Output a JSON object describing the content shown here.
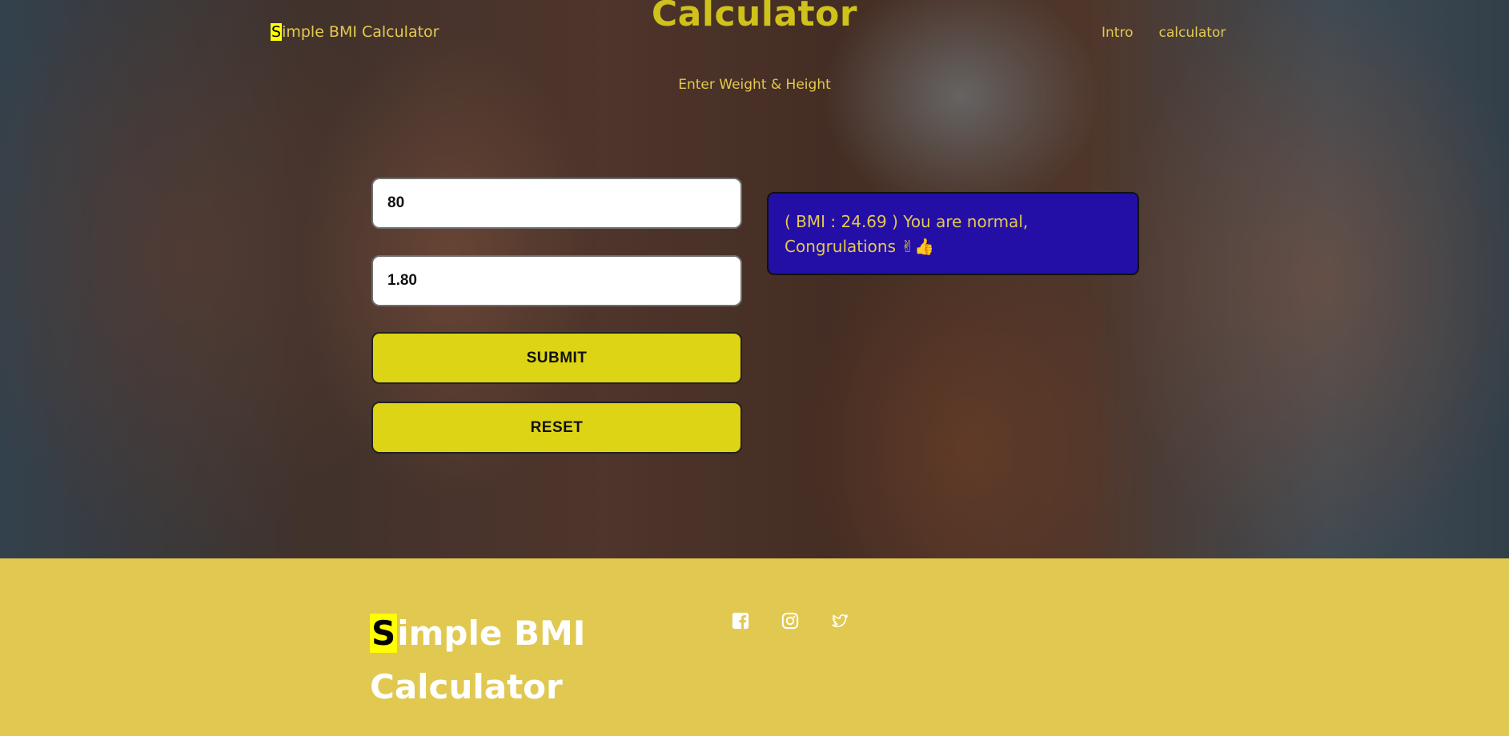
{
  "header": {
    "brand_first": "S",
    "brand_rest": "imple BMI Calculator",
    "title": "Calculator",
    "subtitle": "Enter Weight & Height",
    "nav": [
      {
        "label": "Intro"
      },
      {
        "label": "calculator"
      }
    ]
  },
  "form": {
    "weight_value": "80",
    "height_value": "1.80",
    "submit_label": "SUBMIT",
    "reset_label": "RESET"
  },
  "result": {
    "text": "( BMI : 24.69 ) You are normal, Congrulations ✌👍"
  },
  "footer": {
    "brand_first": "S",
    "brand_line1_rest": "imple BMI",
    "brand_line2": "Calculator",
    "social": [
      "facebook-icon",
      "instagram-icon",
      "twitter-icon"
    ]
  },
  "colors": {
    "accent_text": "#e4c94e",
    "title": "#cfc21a",
    "button": "#ddd416",
    "result_bg": "#230fa6",
    "footer_bg": "#e1c851",
    "highlight": "#ffff00"
  }
}
